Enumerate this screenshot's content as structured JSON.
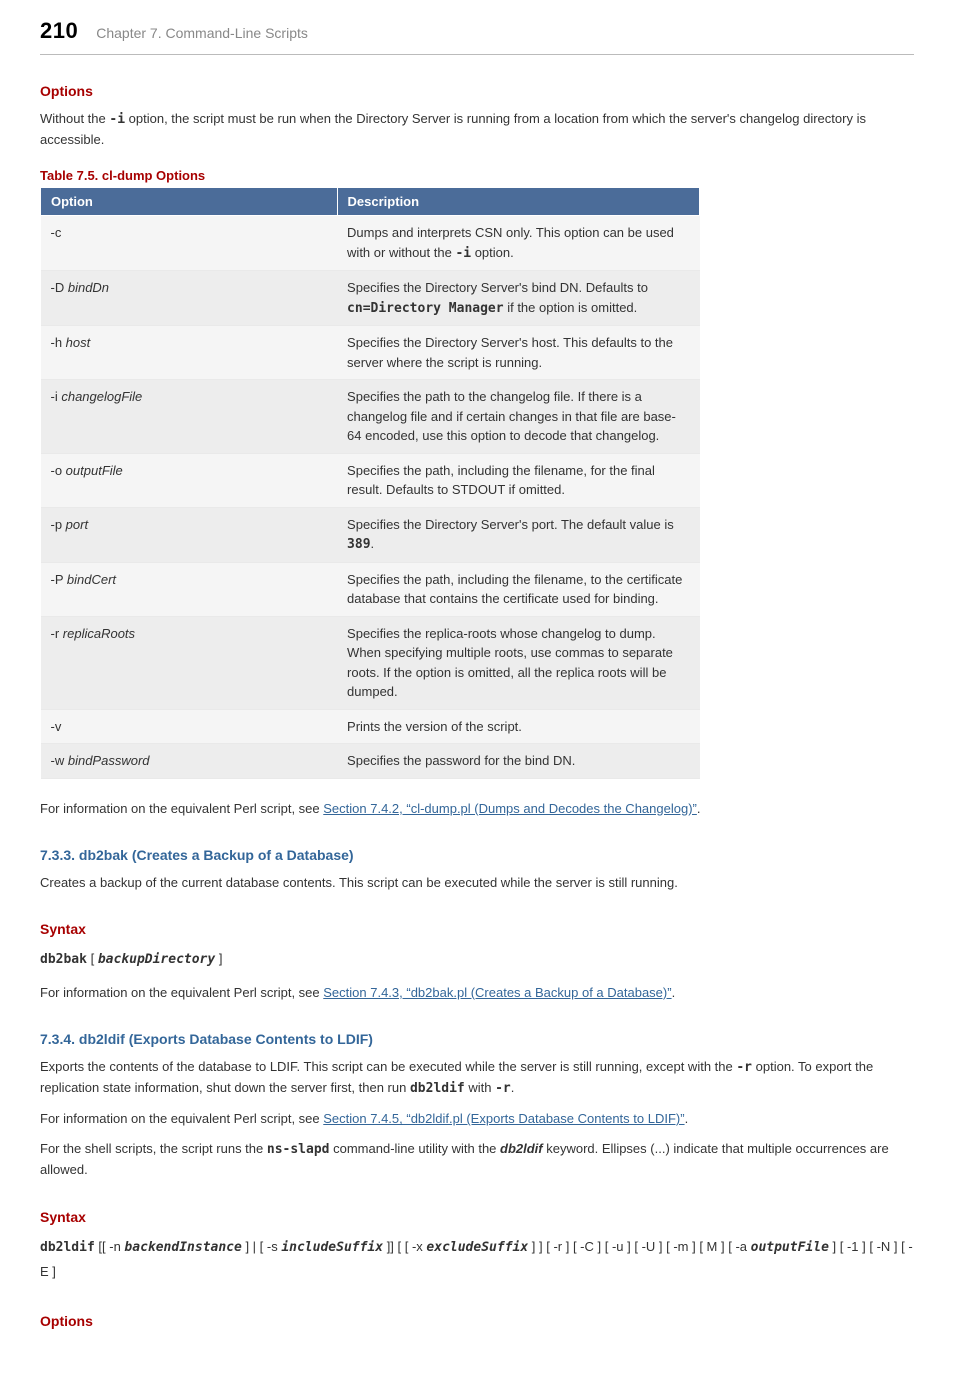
{
  "header": {
    "page_number": "210",
    "chapter": "Chapter 7. Command-Line Scripts"
  },
  "s1": {
    "title": "Options",
    "para_a": "Without the ",
    "flag": "-i",
    "para_b": " option, the script must be run when the Directory Server is running from a location from which the server's changelog directory is accessible."
  },
  "table": {
    "caption": "Table 7.5. cl-dump Options",
    "head": {
      "c1": "Option",
      "c2": "Description"
    },
    "rows": [
      {
        "flag": "-c",
        "arg": "",
        "desc_a": "Dumps and interprets CSN only. This option can be used with or without the ",
        "mono": "-i",
        "desc_b": " option."
      },
      {
        "flag": "-D ",
        "arg": "bindDn",
        "desc_a": "Specifies the Directory Server's bind DN. Defaults to ",
        "mono": "cn=Directory Manager",
        "desc_b": " if the option is omitted."
      },
      {
        "flag": "-h ",
        "arg": "host",
        "desc_a": "Specifies the Directory Server's host. This defaults to the server where the script is running.",
        "mono": "",
        "desc_b": ""
      },
      {
        "flag": "-i ",
        "arg": "changelogFile",
        "desc_a": "Specifies the path to the changelog file. If there is a changelog file and if certain changes in that file are base-64 encoded, use this option to decode that changelog.",
        "mono": "",
        "desc_b": ""
      },
      {
        "flag": "-o ",
        "arg": "outputFile",
        "desc_a": "Specifies the path, including the filename, for the final result. Defaults to STDOUT if omitted.",
        "mono": "",
        "desc_b": ""
      },
      {
        "flag": "-p ",
        "arg": "port",
        "desc_a": "Specifies the Directory Server's port. The default value is ",
        "mono": "389",
        "desc_b": "."
      },
      {
        "flag": "-P ",
        "arg": "bindCert",
        "desc_a": "Specifies the path, including the filename, to the certificate database that contains the certificate used for binding.",
        "mono": "",
        "desc_b": ""
      },
      {
        "flag": "-r ",
        "arg": "replicaRoots",
        "desc_a": "Specifies the replica-roots whose changelog to dump. When specifying multiple roots, use commas to separate roots. If the option is omitted, all the replica roots will be dumped.",
        "mono": "",
        "desc_b": ""
      },
      {
        "flag": "-v",
        "arg": "",
        "desc_a": "Prints the version of the script.",
        "mono": "",
        "desc_b": ""
      },
      {
        "flag": "-w ",
        "arg": "bindPassword",
        "desc_a": "Specifies the password for the bind DN.",
        "mono": "",
        "desc_b": ""
      }
    ]
  },
  "after_table": {
    "lead": "For information on the equivalent Perl script, see ",
    "link": "Section 7.4.2, “cl-dump.pl (Dumps and Decodes the Changelog)”",
    "tail": "."
  },
  "s733": {
    "title": "7.3.3. db2bak (Creates a Backup of a Database)",
    "p1": "Creates a backup of the current database contents. This script can be executed while the server is still running.",
    "syntax_title": "Syntax",
    "syntax_cmd": "db2bak",
    "syntax_lb": " [ ",
    "syntax_arg": "backupDirectory",
    "syntax_rb": " ]",
    "xref_lead": "For information on the equivalent Perl script, see ",
    "xref_link": "Section 7.4.3, “db2bak.pl (Creates a Backup of a Database)”",
    "xref_tail": "."
  },
  "s734": {
    "title": "7.3.4. db2ldif (Exports Database Contents to LDIF)",
    "p1_a": "Exports the contents of the database to LDIF. This script can be executed while the server is still running, except with the ",
    "p1_r1": "-r",
    "p1_b": " option. To export the replication state information, shut down the server first, then run ",
    "p1_cmd": "db2ldif",
    "p1_c": " with ",
    "p1_r2": "-r",
    "p1_d": ".",
    "xref_lead": "For information on the equivalent Perl script, see ",
    "xref_link": "Section 7.4.5, “db2ldif.pl (Exports Database Contents to LDIF)”",
    "xref_tail": ".",
    "p3_a": "For the shell scripts, the script runs the ",
    "p3_cmd": "ns-slapd",
    "p3_b": " command-line utility with the ",
    "p3_kw": "db2ldif",
    "p3_c": " keyword. Ellipses (...) indicate that multiple occurrences are allowed.",
    "syntax_title": "Syntax",
    "syntax": {
      "cmd": "db2ldif",
      "t1": " [[ -n ",
      "a1": "backendInstance",
      "t2": " ] | [ -s ",
      "a2": "includeSuffix",
      "t3": " ]] [ [ -x ",
      "a3": "excludeSuffix",
      "t4": " ] ] [ -r ] [ -C ] [ -u ] [ -U ] [ -m ] [ M ] [ -a ",
      "a4": "outputFile",
      "t5": " ] [ -1 ] [ -N ] [ -E ]"
    },
    "options_title": "Options"
  }
}
